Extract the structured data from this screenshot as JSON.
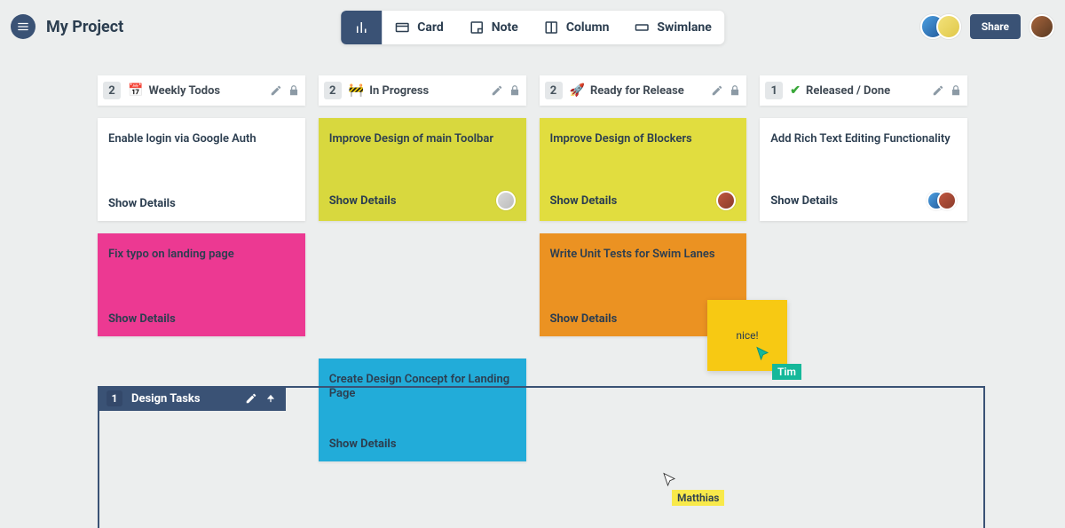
{
  "header": {
    "project_title": "My Project",
    "toolbar": [
      {
        "id": "chart",
        "label": "",
        "icon": "bars"
      },
      {
        "id": "card",
        "label": "Card",
        "icon": "card"
      },
      {
        "id": "note",
        "label": "Note",
        "icon": "note"
      },
      {
        "id": "column",
        "label": "Column",
        "icon": "column"
      },
      {
        "id": "swimlane",
        "label": "Swimlane",
        "icon": "swimlane"
      }
    ],
    "share_label": "Share"
  },
  "columns": [
    {
      "count": "2",
      "icon": "📅",
      "title": "Weekly Todos",
      "cards": [
        {
          "title": "Enable login via Google Auth",
          "details": "Show Details",
          "color": "white",
          "assignees": 0
        },
        {
          "title": "Fix typo on landing page",
          "details": "Show Details",
          "color": "pink",
          "assignees": 0
        }
      ]
    },
    {
      "count": "2",
      "icon": "🚧",
      "title": "In Progress",
      "cards": [
        {
          "title": "Improve Design of main Toolbar",
          "details": "Show Details",
          "color": "olive",
          "assignees": 1
        }
      ]
    },
    {
      "count": "2",
      "icon": "🚀",
      "title": "Ready for Release",
      "cards": [
        {
          "title": "Improve Design of Blockers",
          "details": "Show Details",
          "color": "yelgrn",
          "assignees": 1
        },
        {
          "title": "Write Unit Tests for Swim Lanes",
          "details": "Show Details",
          "color": "orange",
          "assignees": 0
        }
      ]
    },
    {
      "count": "1",
      "icon": "✔️",
      "title": "Released / Done",
      "cards": [
        {
          "title": "Add Rich Text Editing Functionality",
          "details": "Show Details",
          "color": "white",
          "assignees": 2
        }
      ]
    }
  ],
  "swimlane": {
    "count": "1",
    "title": "Design Tasks",
    "cards": [
      {
        "title": "Create Design Concept for Landing Page",
        "details": "Show Details",
        "color": "cyan",
        "column": 1
      }
    ]
  },
  "sticky_note": {
    "text": "nice!"
  },
  "cursors": {
    "tim": "Tim",
    "matthias": "Matthias"
  }
}
